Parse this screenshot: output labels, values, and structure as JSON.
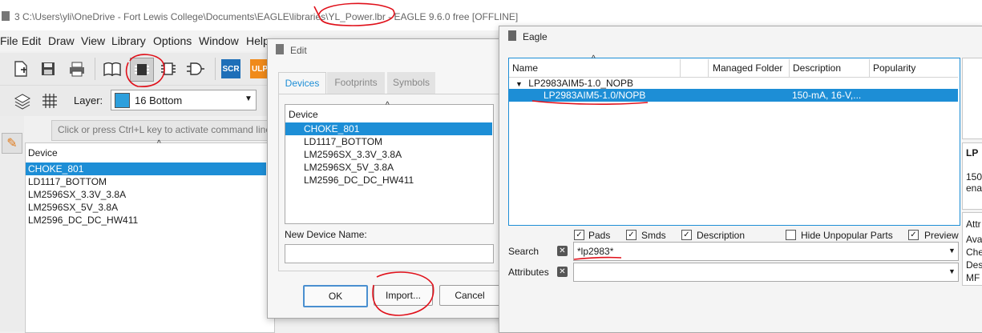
{
  "window": {
    "title": "3 C:\\Users\\yli\\OneDrive - Fort Lewis College\\Documents\\EAGLE\\libraries\\YL_Power.lbr - EAGLE 9.6.0 free [OFFLINE]"
  },
  "menu": [
    "File",
    "Edit",
    "Draw",
    "View",
    "Library",
    "Options",
    "Window",
    "Help"
  ],
  "toolbar": {
    "icons": [
      "new-file-icon",
      "save-icon",
      "print-icon",
      "book-icon",
      "package-icon",
      "chip-icon",
      "gate-icon",
      "scr-icon",
      "ulp-icon"
    ],
    "scr_label": "SCR",
    "ulp_label": "ULP"
  },
  "layer": {
    "label": "Layer:",
    "value": "16 Bottom",
    "swatch_color": "#2d9fdc"
  },
  "command_line": {
    "placeholder": "Click or press Ctrl+L key to activate command line mode"
  },
  "device_list": {
    "header": "Device",
    "items": [
      "CHOKE_801",
      "LD1117_BOTTOM",
      "LM2596SX_3.3V_3.8A",
      "LM2596SX_5V_3.8A",
      "LM2596_DC_DC_HW411"
    ],
    "selected": "CHOKE_801"
  },
  "edit_dialog": {
    "title": "Edit",
    "tabs": [
      "Devices",
      "Footprints",
      "Symbols"
    ],
    "list_header": "Device",
    "items": [
      "CHOKE_801",
      "LD1117_BOTTOM",
      "LM2596SX_3.3V_3.8A",
      "LM2596SX_5V_3.8A",
      "LM2596_DC_DC_HW411"
    ],
    "new_name_label": "New Device Name:",
    "new_name_value": "",
    "buttons": {
      "ok": "OK",
      "import": "Import...",
      "cancel": "Cancel"
    }
  },
  "eagle_dialog": {
    "title": "Eagle",
    "columns": [
      "Name",
      "Managed Folder",
      "Description",
      "Popularity"
    ],
    "tree": {
      "parent": "LP2983AIM5-1.0_NOPB",
      "child": "LP2983AIM5-1.0/NOPB",
      "child_description": "150-mA, 16-V,..."
    },
    "checkboxes": [
      {
        "label": "Pads",
        "checked": true
      },
      {
        "label": "Smds",
        "checked": true
      },
      {
        "label": "Description",
        "checked": true
      },
      {
        "label": "Hide Unpopular Parts",
        "checked": false
      },
      {
        "label": "Preview",
        "checked": true
      }
    ],
    "search_label": "Search",
    "search_value": "*lp2983*",
    "attributes_label": "Attributes",
    "attributes_value": "",
    "side_clips": {
      "desc_title": "LP",
      "desc_lines": [
        "150",
        "ena"
      ],
      "attr_header": "Attr",
      "attr_lines": [
        "Ava",
        "Che",
        "Des",
        "MF"
      ]
    }
  },
  "colors": {
    "selection": "#1d8ed6",
    "annotation": "#e0101a"
  }
}
